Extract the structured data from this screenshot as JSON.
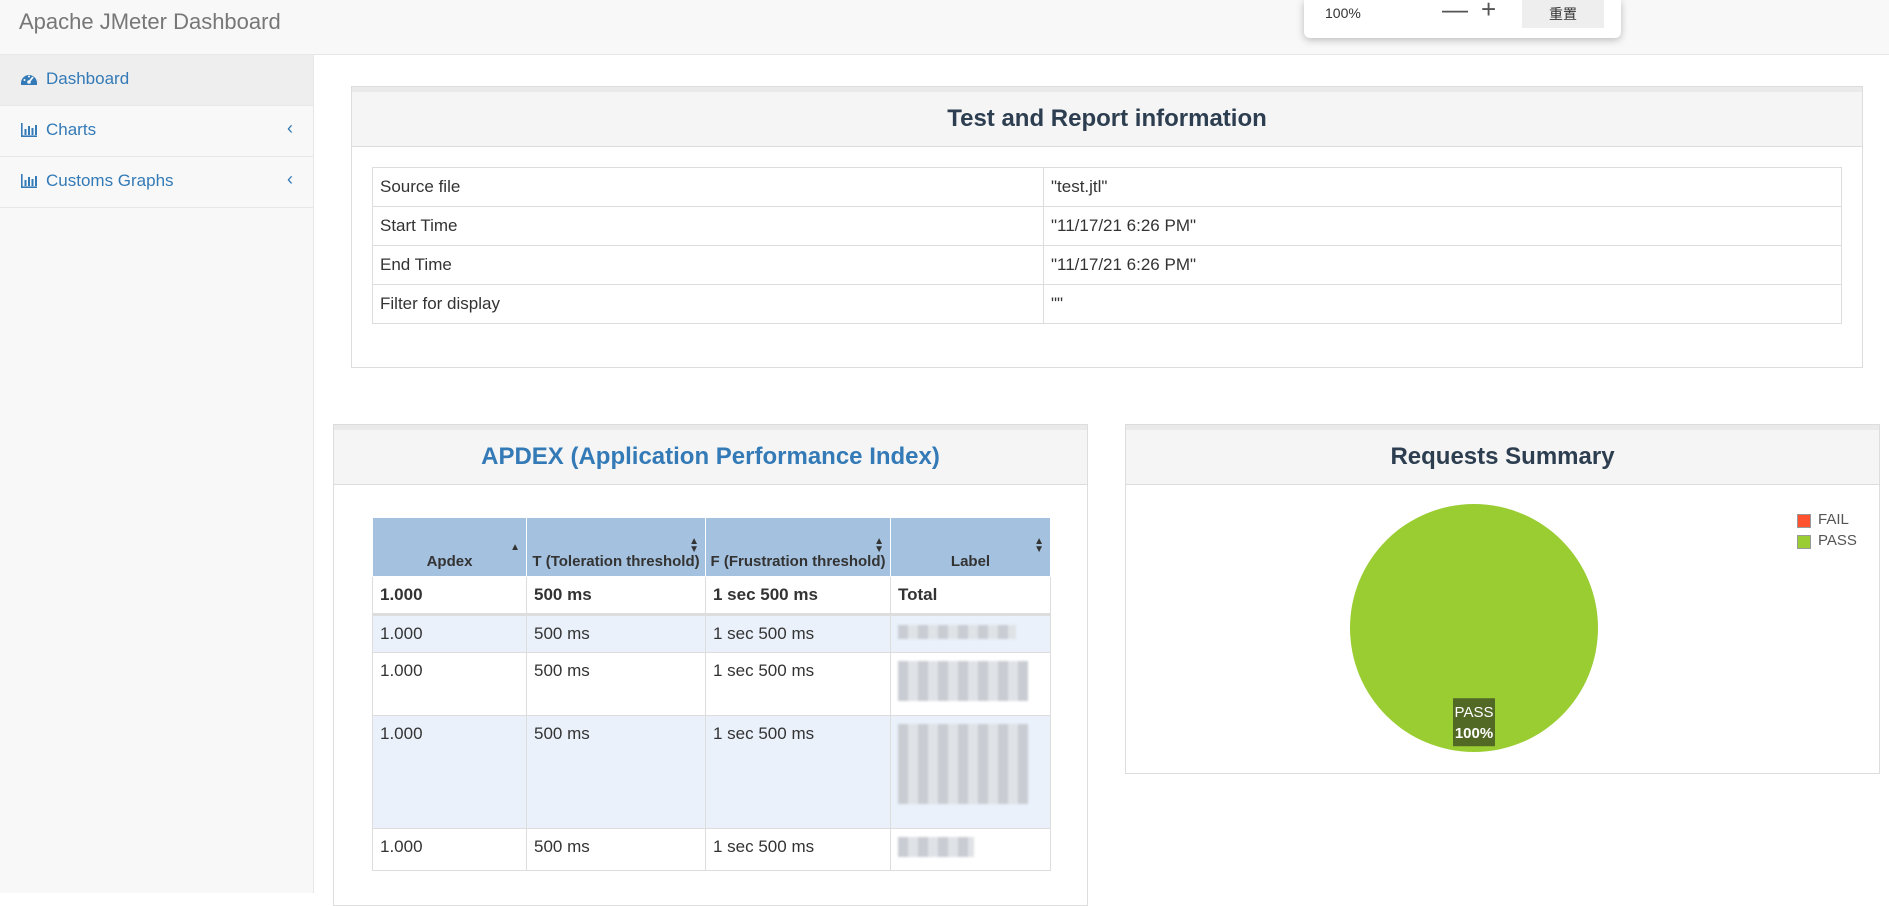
{
  "app": {
    "title": "Apache JMeter Dashboard"
  },
  "zoom": {
    "value": "100%",
    "minus": "—",
    "plus": "+",
    "reset": "重置"
  },
  "sidebar": {
    "items": [
      {
        "label": "Dashboard",
        "icon": "dashboard-icon"
      },
      {
        "label": "Charts",
        "icon": "bar-chart-icon",
        "chevron": "‹"
      },
      {
        "label": "Customs Graphs",
        "icon": "bar-chart-icon",
        "chevron": "‹"
      }
    ]
  },
  "test_info": {
    "title": "Test and Report information",
    "rows": [
      {
        "key": "Source file",
        "value": "\"test.jtl\""
      },
      {
        "key": "Start Time",
        "value": "\"11/17/21 6:26 PM\""
      },
      {
        "key": "End Time",
        "value": "\"11/17/21 6:26 PM\""
      },
      {
        "key": "Filter for display",
        "value": "\"\""
      }
    ]
  },
  "apdex": {
    "title": "APDEX (Application Performance Index)",
    "headers": [
      "Apdex",
      "T (Toleration threshold)",
      "F (Frustration threshold)",
      "Label"
    ],
    "total": {
      "apdex": "1.000",
      "t": "500 ms",
      "f": "1 sec 500 ms",
      "label": "Total"
    },
    "rows": [
      {
        "apdex": "1.000",
        "t": "500 ms",
        "f": "1 sec 500 ms"
      },
      {
        "apdex": "1.000",
        "t": "500 ms",
        "f": "1 sec 500 ms"
      },
      {
        "apdex": "1.000",
        "t": "500 ms",
        "f": "1 sec 500 ms"
      },
      {
        "apdex": "1.000",
        "t": "500 ms",
        "f": "1 sec 500 ms"
      }
    ]
  },
  "requests_summary": {
    "title": "Requests Summary",
    "slice_label": "PASS",
    "slice_pct": "100%"
  },
  "chart_data": {
    "type": "pie",
    "title": "Requests Summary",
    "categories": [
      "FAIL",
      "PASS"
    ],
    "values": [
      0,
      100
    ],
    "colors": [
      "#ff5330",
      "#9acd32"
    ],
    "legend": "top-right"
  },
  "colors": {
    "accent": "#337ab7",
    "pass": "#9acd32",
    "fail": "#ff5330",
    "table_header": "#a4c1df"
  }
}
